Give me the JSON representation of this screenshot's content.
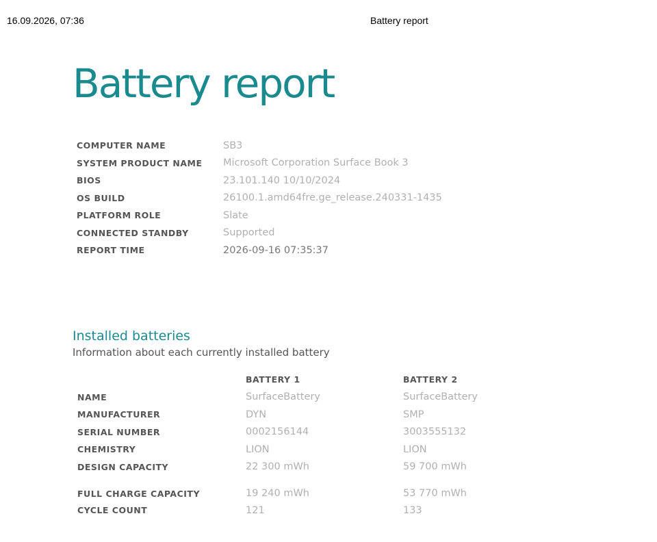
{
  "print_header": {
    "date": "16.09.2026, 07:36",
    "title": "Battery report"
  },
  "title": "Battery report",
  "system_info": [
    {
      "label": "COMPUTER NAME",
      "value": "SB3"
    },
    {
      "label": "SYSTEM PRODUCT NAME",
      "value": "Microsoft Corporation Surface Book 3"
    },
    {
      "label": "BIOS",
      "value": "23.101.140 10/10/2024"
    },
    {
      "label": "OS BUILD",
      "value": "26100.1.amd64fre.ge_release.240331-1435"
    },
    {
      "label": "PLATFORM ROLE",
      "value": "Slate"
    },
    {
      "label": "CONNECTED STANDBY",
      "value": "Supported"
    },
    {
      "label": "REPORT TIME",
      "value": "2026-09-16 07:35:37"
    }
  ],
  "installed_batteries": {
    "title": "Installed batteries",
    "subtitle": "Information about each currently installed battery",
    "headers": [
      "BATTERY 1",
      "BATTERY 2"
    ],
    "rows": [
      {
        "label": "NAME",
        "values": [
          "SurfaceBattery",
          "SurfaceBattery"
        ]
      },
      {
        "label": "MANUFACTURER",
        "values": [
          "DYN",
          "SMP"
        ]
      },
      {
        "label": "SERIAL NUMBER",
        "values": [
          "0002156144",
          "3003555132"
        ]
      },
      {
        "label": "CHEMISTRY",
        "values": [
          "LION",
          "LION"
        ]
      },
      {
        "label": "DESIGN CAPACITY",
        "values": [
          "22 300 mWh",
          "59 700 mWh"
        ]
      },
      {
        "label": "FULL CHARGE CAPACITY",
        "values": [
          "19 240 mWh",
          "53 770 mWh"
        ]
      },
      {
        "label": "CYCLE COUNT",
        "values": [
          "121",
          "133"
        ]
      }
    ]
  },
  "colors": {
    "accent": "#1a8a8f",
    "label": "#555555",
    "value": "#b0b0b0"
  }
}
